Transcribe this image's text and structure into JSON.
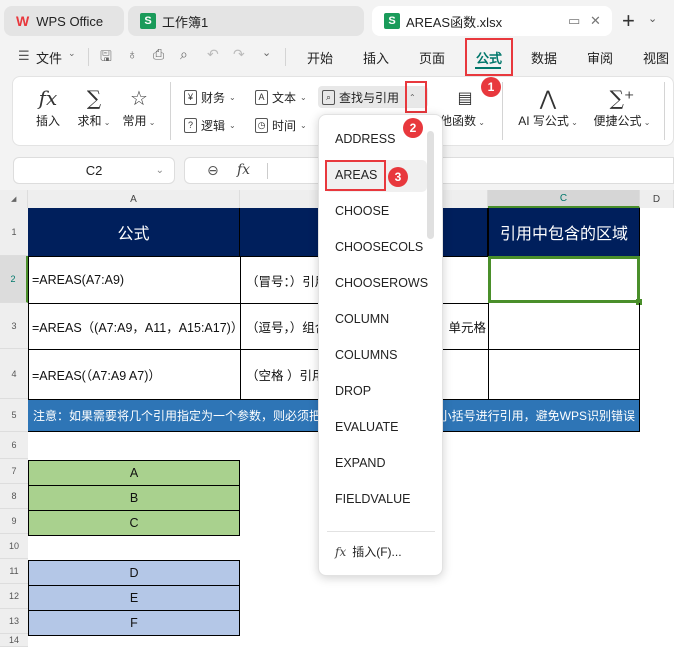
{
  "tabs": [
    {
      "label": "WPS Office",
      "icon": "wps-logo-icon"
    },
    {
      "label": "工作簿1",
      "icon": "spreadsheet-icon"
    },
    {
      "label": "AREAS函数.xlsx",
      "icon": "spreadsheet-icon",
      "active": true
    }
  ],
  "tab_controls": {
    "new_tab": "+",
    "dropdown": "⌄",
    "monitor": "▭",
    "close": "✕"
  },
  "menu": {
    "file_label": "文件",
    "items": [
      "开始",
      "插入",
      "页面",
      "公式",
      "数据",
      "审阅",
      "视图"
    ],
    "active": "公式"
  },
  "ribbon": {
    "insert_fn": "插入",
    "sum": "求和",
    "common": "常用",
    "finance": "财务",
    "text": "文本",
    "lookup": "查找与引用",
    "logic": "逻辑",
    "time": "时间",
    "other_fn": "他函数",
    "ai_formula": "AI 写公式",
    "quick_formula": "便捷公式"
  },
  "formula_bar": {
    "cell_ref": "C2",
    "fx": "fx",
    "value": ""
  },
  "columns": [
    "A",
    "C",
    "D"
  ],
  "rows": [
    "1",
    "2",
    "3",
    "4",
    "5",
    "6",
    "7",
    "8",
    "9",
    "10",
    "11",
    "12",
    "13",
    "14"
  ],
  "table": {
    "header_a": "公式",
    "header_c": "引用中包含的区域",
    "row2": {
      "a": "=AREAS(A7:A9)",
      "b": "（冒号：）引用"
    },
    "row3": {
      "a": "=AREAS（(A7:A9，A11，A15:A17)）",
      "b": "（逗号，）组合",
      "b_tail": "单元格"
    },
    "row4": {
      "a": "=AREAS(（A7:A9 A7)）",
      "b": "（空格 ）引用"
    },
    "note_left": "注意：如果需要将几个引用指定为一个参数，则必须把",
    "note_right": "小括号进行引用，避免WPS识别错误"
  },
  "blocks": {
    "green": [
      "A",
      "B",
      "C"
    ],
    "blue": [
      "D",
      "E",
      "F"
    ]
  },
  "dropdown": {
    "items": [
      "ADDRESS",
      "AREAS",
      "CHOOSE",
      "CHOOSECOLS",
      "CHOOSEROWS",
      "COLUMN",
      "COLUMNS",
      "DROP",
      "EVALUATE",
      "EXPAND",
      "FIELDVALUE"
    ],
    "highlighted": "AREAS",
    "insert_label": "插入(F)..."
  },
  "annotations": [
    "1",
    "2",
    "3"
  ],
  "colors": {
    "accent": "#00776b",
    "annotation_red": "#e8383d",
    "header_navy": "#001f5c",
    "note_blue": "#2e75b6",
    "green_fill": "#a9d18e",
    "blue_fill": "#b4c7e7",
    "selection_green": "#4a8f2a"
  }
}
